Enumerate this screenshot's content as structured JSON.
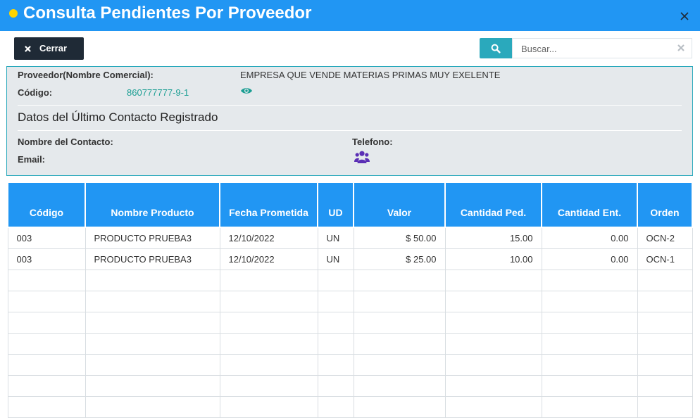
{
  "window": {
    "title": "Consulta Pendientes Por Proveedor"
  },
  "toolbar": {
    "close_label": "Cerrar"
  },
  "search": {
    "placeholder": "Buscar..."
  },
  "supplier": {
    "name_label": "Proveedor(Nombre Comercial):",
    "name_value": "EMPRESA QUE VENDE MATERIAS PRIMAS MUY EXELENTE",
    "code_label": "Código:",
    "code_value": "860777777-9-1"
  },
  "contact": {
    "section_title": "Datos del Último Contacto Registrado",
    "name_label": "Nombre del Contacto:",
    "phone_label": "Telefono:",
    "email_label": "Email:"
  },
  "table": {
    "headers": [
      "Código",
      "Nombre Producto",
      "Fecha Prometida",
      "UD",
      "Valor",
      "Cantidad Ped.",
      "Cantidad Ent.",
      "Orden"
    ],
    "rows": [
      [
        "003",
        "PRODUCTO PRUEBA3",
        "12/10/2022",
        "UN",
        "$ 50.00",
        "15.00",
        "0.00",
        "OCN-2"
      ],
      [
        "003",
        "PRODUCTO PRUEBA3",
        "12/10/2022",
        "UN",
        "$ 25.00",
        "10.00",
        "0.00",
        "OCN-1"
      ]
    ]
  },
  "colors": {
    "header_blue": "#2196f3",
    "teal": "#2aa9bc",
    "dark_button": "#1f2a36",
    "title_dot": "#ffd400",
    "users_icon": "#5b2fb5"
  }
}
